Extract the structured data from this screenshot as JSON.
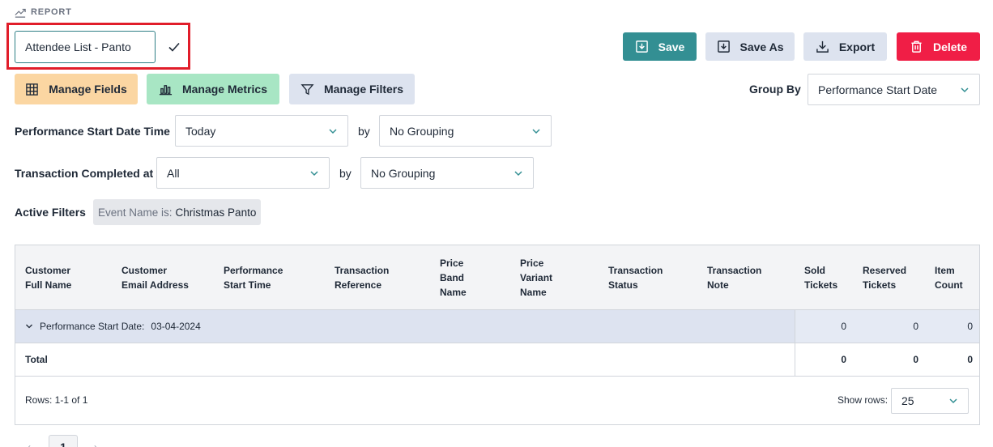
{
  "header": {
    "section_label": "REPORT"
  },
  "report_name": {
    "value": "Attendee List - Panto"
  },
  "actions": {
    "save": "Save",
    "save_as": "Save As",
    "export": "Export",
    "delete": "Delete"
  },
  "tools": {
    "manage_fields": "Manage Fields",
    "manage_metrics": "Manage Metrics",
    "manage_filters": "Manage Filters"
  },
  "group_by": {
    "label": "Group By",
    "value": "Performance Start Date"
  },
  "performance_filter": {
    "label": "Performance Start Date Time",
    "range": "Today",
    "by_label": "by",
    "grouping": "No Grouping"
  },
  "transaction_filter": {
    "label": "Transaction Completed at",
    "range": "All",
    "by_label": "by",
    "grouping": "No Grouping"
  },
  "active_filters": {
    "label": "Active Filters",
    "chips": [
      {
        "key": "Event Name is:",
        "value": "Christmas Panto"
      }
    ]
  },
  "table": {
    "columns": [
      [
        "Customer",
        "Full Name"
      ],
      [
        "Customer",
        "Email Address"
      ],
      [
        "Performance",
        "Start Time"
      ],
      [
        "Transaction",
        "Reference"
      ],
      [
        "Price",
        "Band",
        "Name"
      ],
      [
        "Price",
        "Variant",
        "Name"
      ],
      [
        "Transaction",
        "Status"
      ],
      [
        "Transaction",
        "Note"
      ],
      [
        "Sold",
        "Tickets"
      ],
      [
        "Reserved",
        "Tickets"
      ],
      [
        "Item",
        "Count"
      ]
    ],
    "group_row": {
      "label": "Performance Start Date:",
      "value": "03-04-2024",
      "sold": "0",
      "reserved": "0",
      "items": "0"
    },
    "total_row": {
      "label": "Total",
      "sold": "0",
      "reserved": "0",
      "items": "0"
    },
    "rows_info": "Rows: 1-1 of 1",
    "show_rows_label": "Show rows:",
    "show_rows_value": "25"
  },
  "pagination": {
    "current_page": "1"
  },
  "colors": {
    "accent": "#338f93",
    "danger": "#f01e46",
    "highlight_border": "#e11d2a"
  }
}
